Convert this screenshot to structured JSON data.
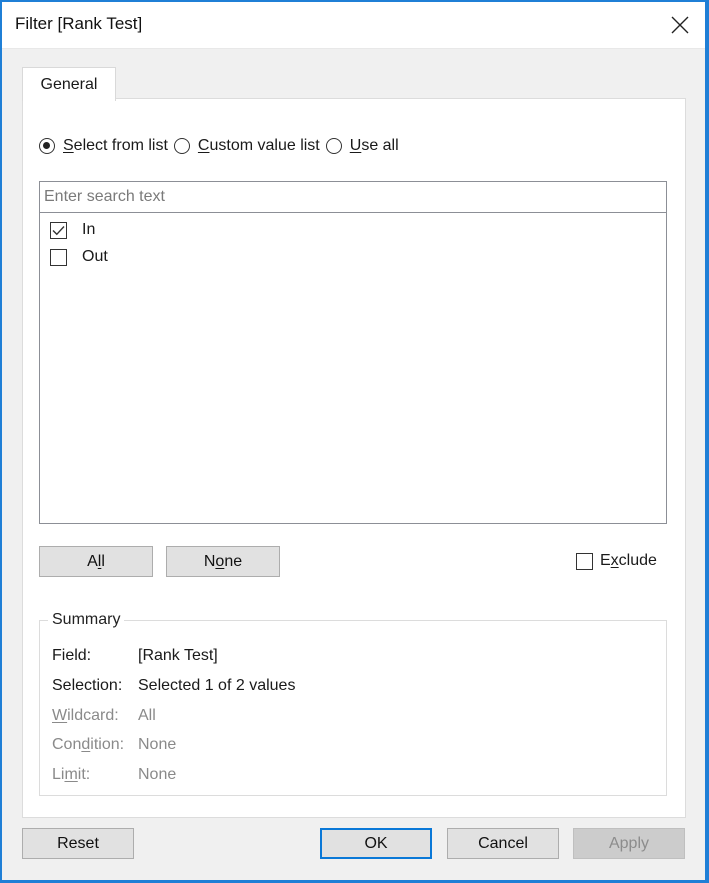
{
  "window": {
    "title": "Filter [Rank Test]",
    "close_icon": "close-icon"
  },
  "tabs": [
    {
      "label": "General",
      "active": true
    }
  ],
  "mode_options": [
    {
      "label_pre": "",
      "label_ul": "S",
      "label_post": "elect from list",
      "selected": true
    },
    {
      "label_pre": "",
      "label_ul": "C",
      "label_post": "ustom value list",
      "selected": false
    },
    {
      "label_pre": "",
      "label_ul": "U",
      "label_post": "se all",
      "selected": false
    }
  ],
  "list": {
    "search_placeholder": "Enter search text",
    "search_value": "",
    "items": [
      {
        "label": "In",
        "checked": true
      },
      {
        "label": "Out",
        "checked": false
      }
    ]
  },
  "list_buttons": {
    "all": {
      "pre": "A",
      "ul": "l",
      "post": "l"
    },
    "none": {
      "pre": "N",
      "ul": "o",
      "post": "ne"
    }
  },
  "exclude": {
    "pre": "E",
    "ul": "x",
    "post": "clude",
    "checked": false
  },
  "summary": {
    "title": "Summary",
    "rows": [
      {
        "label": "Field:",
        "value": "[Rank Test]",
        "enabled": true
      },
      {
        "label": "Selection:",
        "value": "Selected 1 of 2 values",
        "enabled": true
      },
      {
        "label_pre": "",
        "label_ul": "W",
        "label_post": "ildcard:",
        "value": "All",
        "enabled": false
      },
      {
        "label_pre": "Con",
        "label_ul": "d",
        "label_post": "ition:",
        "value": "None",
        "enabled": false
      },
      {
        "label_pre": "Li",
        "label_ul": "m",
        "label_post": "it:",
        "value": "None",
        "enabled": false
      }
    ]
  },
  "footer": {
    "reset": "Reset",
    "ok": "OK",
    "cancel": "Cancel",
    "apply": "Apply",
    "apply_enabled": false
  },
  "colors": {
    "window_border": "#1f7fd6",
    "ok_focus": "#0a78d7",
    "disabled_text": "#8a8a8a"
  }
}
